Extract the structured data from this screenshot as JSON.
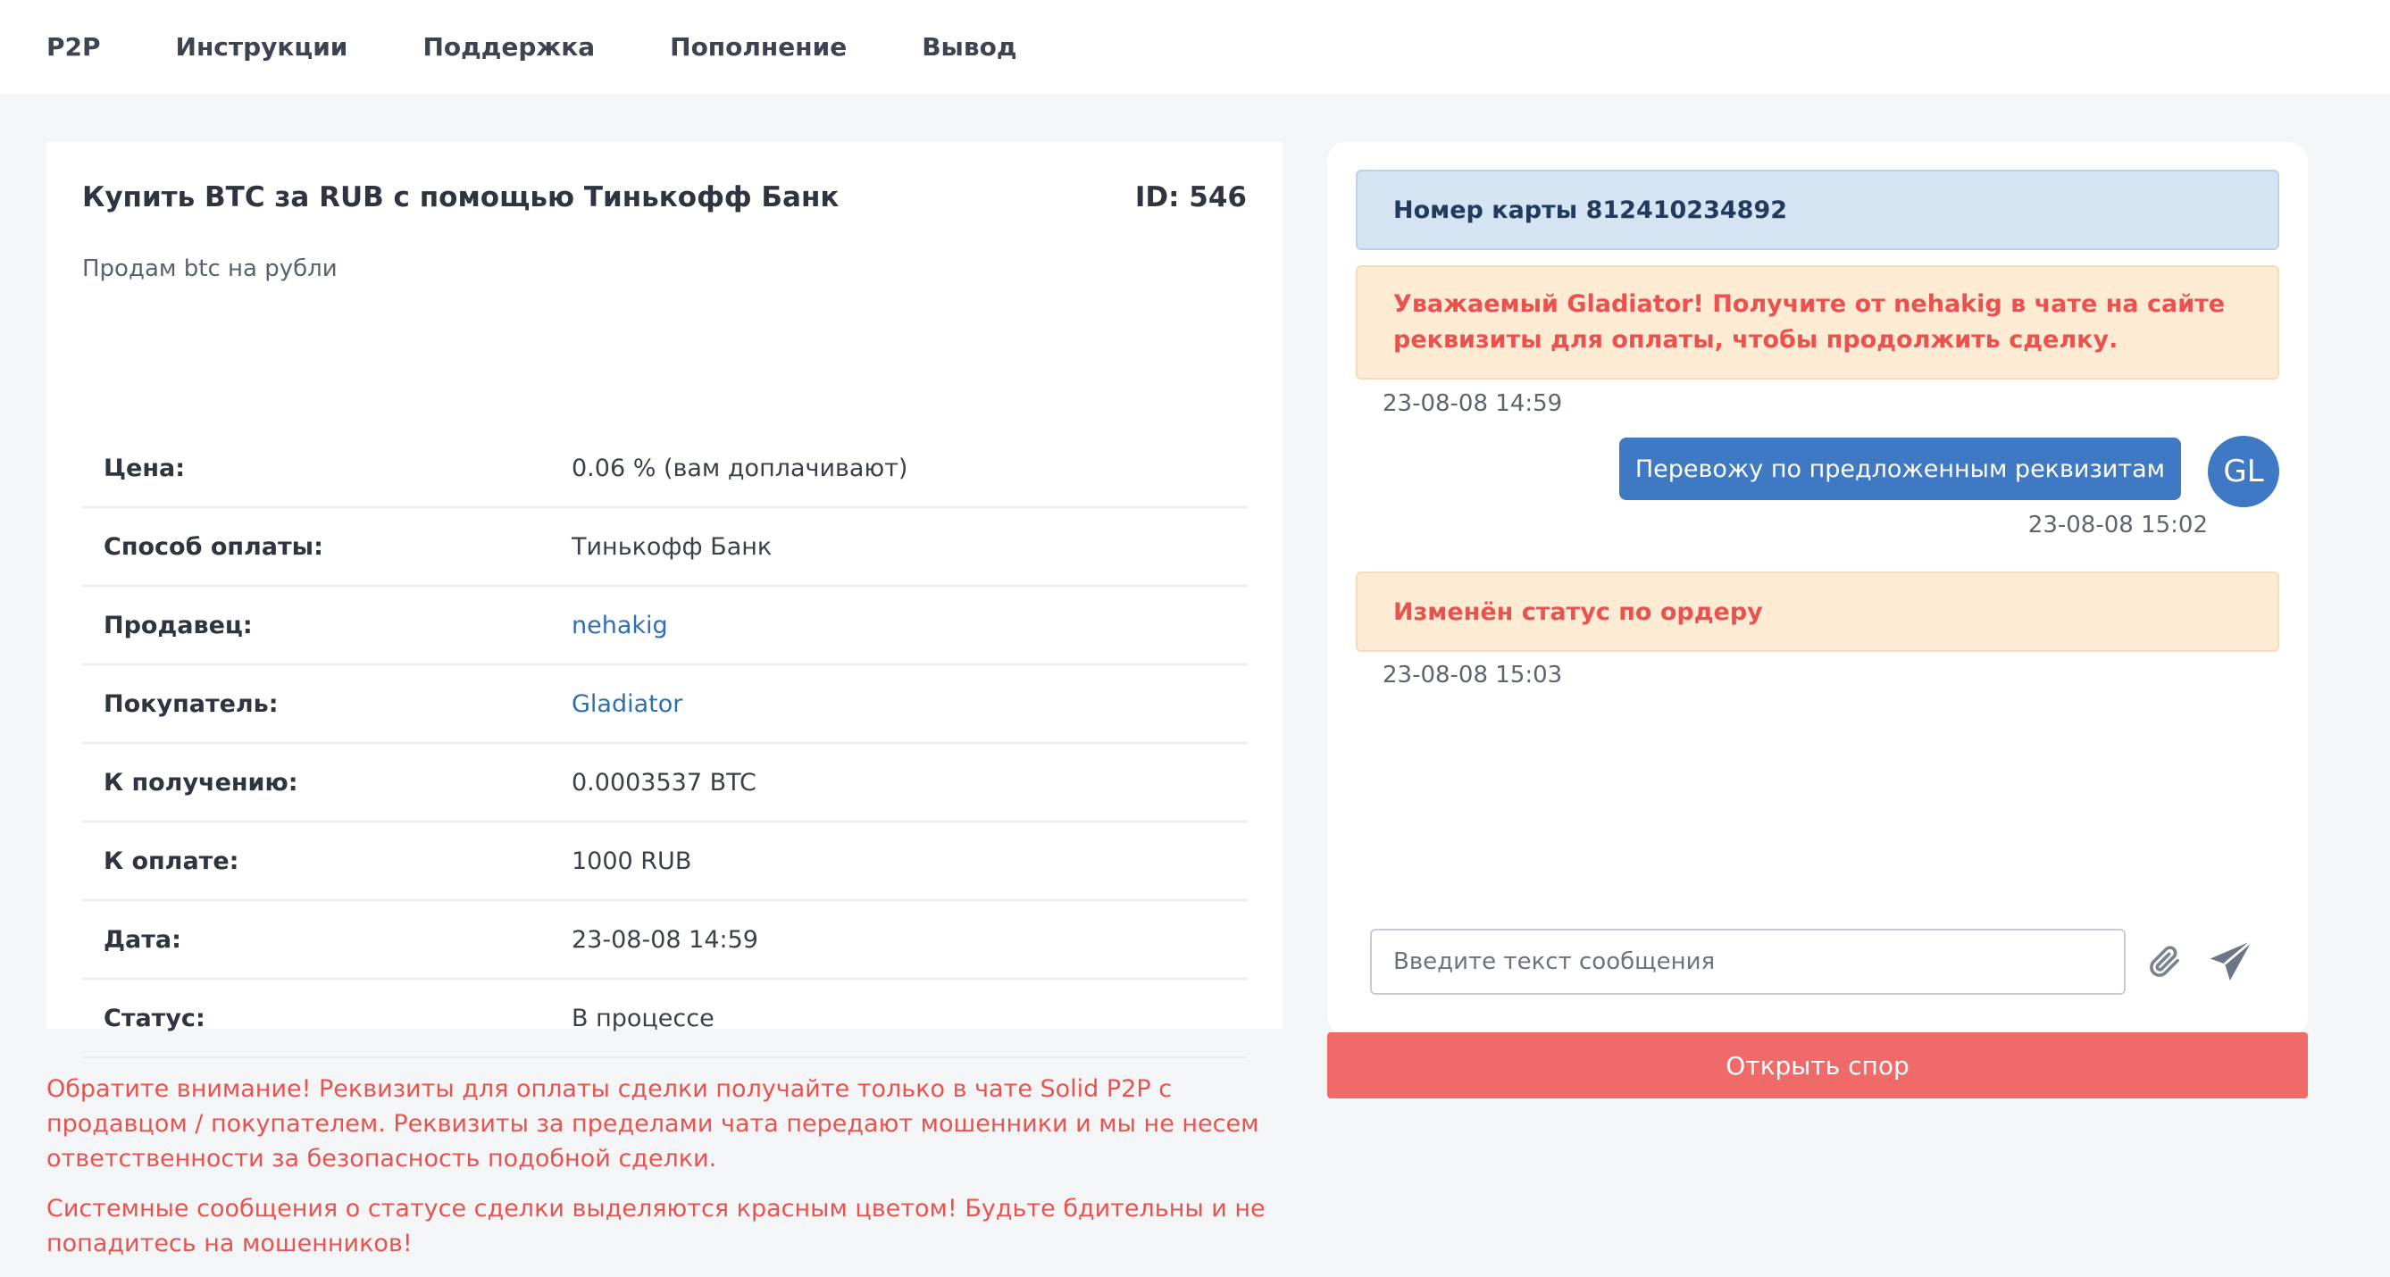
{
  "nav": {
    "items": [
      {
        "label": "P2P"
      },
      {
        "label": "Инструкции"
      },
      {
        "label": "Поддержка"
      },
      {
        "label": "Пополнение"
      },
      {
        "label": "Вывод"
      }
    ]
  },
  "order": {
    "title": "Купить BTC за RUB с помощью Тинькофф Банк",
    "id_label": "ID: 546",
    "description": "Продам btc на рубли",
    "rows": [
      {
        "label": "Цена:",
        "value": "0.06 % (вам доплачивают)"
      },
      {
        "label": "Способ оплаты:",
        "value": "Тинькофф Банк"
      },
      {
        "label": "Продавец:",
        "value": "nehakig"
      },
      {
        "label": "Покупатель:",
        "value": "Gladiator"
      },
      {
        "label": "К получению:",
        "value": "0.0003537 BTC"
      },
      {
        "label": "К оплате:",
        "value": "1000 RUB"
      },
      {
        "label": "Дата:",
        "value": "23-08-08 14:59"
      },
      {
        "label": "Статус:",
        "value": "В процессе"
      }
    ]
  },
  "warnings": {
    "text1": "Обратите внимание! Реквизиты для оплаты сделки получайте только в чате Solid P2P с продавцом / покупателем. Реквизиты за пределами чата передают мошенники и мы не несем ответственности за безопасность подобной сделки.",
    "text2": "Системные сообщения о статусе сделки выделяются красным цветом! Будьте бдительны и не попадитесь на мошенников!"
  },
  "chat": {
    "card_number": "Номер карты 812410234892",
    "system_message_1": "Уважаемый Gladiator! Получите от nehakig в чате на сайте реквизиты для оплаты, чтобы продолжить сделку.",
    "system_message_1_time": "23-08-08 14:59",
    "user_message": "Перевожу по предложенным реквизитам",
    "user_message_time": "23-08-08 15:02",
    "avatar_initials": "GL",
    "system_message_2": "Изменён статус по ордеру",
    "system_message_2_time": "23-08-08 15:03",
    "input_placeholder": "Введите текст сообщения"
  },
  "dispute_button_label": "Открыть спор",
  "icons": {
    "attach": "paperclip-icon",
    "send": "paper-plane-icon"
  },
  "colors": {
    "accent_blue": "#3f79c4",
    "link_blue": "#2f6db5",
    "danger_red": "#f06a6a",
    "warning_text": "#e8534f",
    "info_bg": "#d4e4f3",
    "warning_bg": "#fdebd4"
  }
}
